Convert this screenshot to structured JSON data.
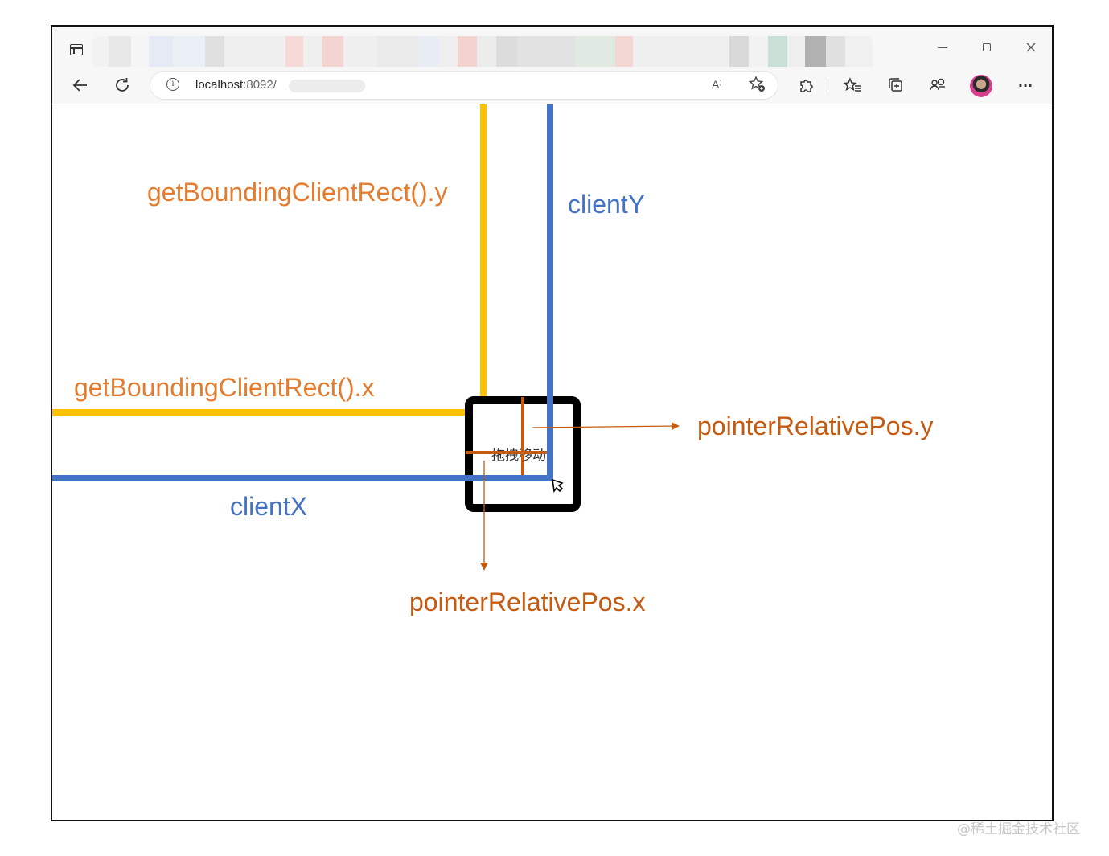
{
  "browser": {
    "window_controls": {
      "minimize_label": "Minimize",
      "maximize_label": "Maximize",
      "close_label": "Close"
    },
    "address_bar": {
      "host": "localhost",
      "port_path": ":8092/"
    },
    "toolbar_icons": [
      "back-arrow-icon",
      "refresh-icon",
      "info-icon",
      "read-aloud-icon",
      "add-favorite-icon",
      "extensions-icon",
      "favorites-icon",
      "collections-icon",
      "copilot-icon",
      "profile-avatar",
      "more-icon"
    ],
    "read_aloud_glyph": "A⁾",
    "more_glyph": "···"
  },
  "page": {
    "draggable_box": {
      "label": "拖拽移动"
    }
  },
  "annotations": {
    "rect_y": "getBoundingClientRect().y",
    "client_y": "clientY",
    "rect_x": "getBoundingClientRect().x",
    "relative_y": "pointerRelativePos.y",
    "client_x": "clientX",
    "relative_x": "pointerRelativePos.x"
  },
  "colors": {
    "rect_line": "#ffc000",
    "client_line": "#4472c4",
    "relative_line": "#c55a11",
    "box_border": "#000000"
  },
  "watermark": "@稀土掘金技术社区"
}
